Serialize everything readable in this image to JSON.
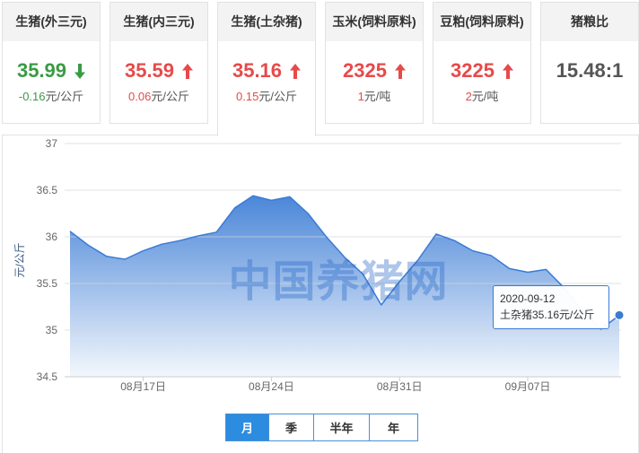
{
  "cards": [
    {
      "title": "生猪(外三元)",
      "value": "35.99",
      "direction": "down",
      "change": "-0.16",
      "unit": "元/公斤",
      "selected": false
    },
    {
      "title": "生猪(内三元)",
      "value": "35.59",
      "direction": "up",
      "change": "0.06",
      "unit": "元/公斤",
      "selected": false
    },
    {
      "title": "生猪(土杂猪)",
      "value": "35.16",
      "direction": "up",
      "change": "0.15",
      "unit": "元/公斤",
      "selected": true
    },
    {
      "title": "玉米(饲料原料)",
      "value": "2325",
      "direction": "up",
      "change": "1",
      "unit": "元/吨",
      "selected": false
    },
    {
      "title": "豆粕(饲料原料)",
      "value": "3225",
      "direction": "up",
      "change": "2",
      "unit": "元/吨",
      "selected": false
    },
    {
      "title": "猪粮比",
      "value": "15.48:1",
      "selected": false
    }
  ],
  "icons": {
    "up": "arrow-up-icon",
    "down": "arrow-down-icon"
  },
  "colors": {
    "up": "#e64a4a",
    "down": "#3a9b44",
    "neutral": "#555555",
    "series": "#3a7bd5",
    "active_button": "#2b8ce0"
  },
  "watermark": "中国养猪网",
  "chart_data": {
    "type": "area",
    "ylabel": "元/公斤",
    "ylim": [
      34.5,
      37
    ],
    "yticks": [
      37,
      36.5,
      36,
      35.5,
      35,
      34.5
    ],
    "xtick_labels": [
      "08月17日",
      "08月24日",
      "08月31日",
      "09月07日"
    ],
    "grid": true,
    "x": [
      "2020-08-13",
      "2020-08-14",
      "2020-08-15",
      "2020-08-16",
      "2020-08-17",
      "2020-08-18",
      "2020-08-19",
      "2020-08-20",
      "2020-08-21",
      "2020-08-22",
      "2020-08-23",
      "2020-08-24",
      "2020-08-25",
      "2020-08-26",
      "2020-08-27",
      "2020-08-28",
      "2020-08-29",
      "2020-08-30",
      "2020-08-31",
      "2020-09-01",
      "2020-09-02",
      "2020-09-03",
      "2020-09-04",
      "2020-09-05",
      "2020-09-06",
      "2020-09-07",
      "2020-09-08",
      "2020-09-09",
      "2020-09-10",
      "2020-09-11",
      "2020-09-12"
    ],
    "series": [
      {
        "values": [
          36.06,
          35.91,
          35.79,
          35.76,
          35.85,
          35.92,
          35.96,
          36.01,
          36.05,
          36.31,
          36.44,
          36.39,
          36.43,
          36.25,
          36.0,
          35.78,
          35.6,
          35.27,
          35.52,
          35.75,
          36.03,
          35.96,
          35.85,
          35.8,
          35.66,
          35.62,
          35.65,
          35.45,
          35.2,
          35.01,
          35.16
        ]
      }
    ],
    "highlight": {
      "x": "2020-09-12",
      "y": 35.16
    },
    "tooltip": {
      "date": "2020-09-12",
      "text": "土杂猪35.16元/公斤"
    }
  },
  "range_buttons": [
    {
      "label": "月",
      "active": true
    },
    {
      "label": "季",
      "active": false
    },
    {
      "label": "半年",
      "active": false
    },
    {
      "label": "年",
      "active": false
    }
  ]
}
